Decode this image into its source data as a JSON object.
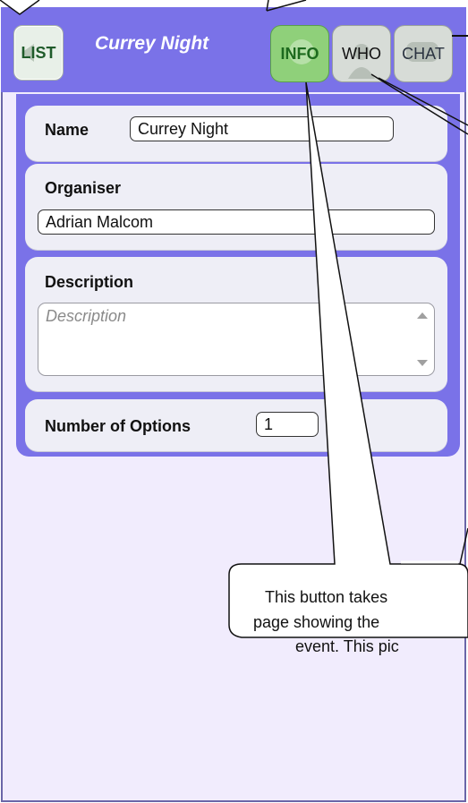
{
  "header": {
    "back_button_label": "LIST",
    "event_title": "Currey Night",
    "tabs": [
      {
        "label": "INFO",
        "active": true
      },
      {
        "label": "WHO",
        "active": false
      },
      {
        "label": "CHAT",
        "active": false
      }
    ]
  },
  "form": {
    "name_label": "Name",
    "name_value": "Currey Night",
    "organiser_label": "Organiser",
    "organiser_value": "Adrian Malcom",
    "description_label": "Description",
    "description_placeholder": "Description",
    "options_label": "Number of Options",
    "options_value": "1"
  },
  "callout": {
    "line1": "This button takes",
    "line2": "page showing the",
    "line3": "event. This pic"
  },
  "colors": {
    "header": "#7a72e8",
    "background": "#f1ecfd",
    "active_tab": "#8fd07a",
    "inactive_tab": "#d7dcd7"
  },
  "icons": [
    "back-arrow-icon",
    "info-icon",
    "person-icon",
    "chat-icon"
  ]
}
